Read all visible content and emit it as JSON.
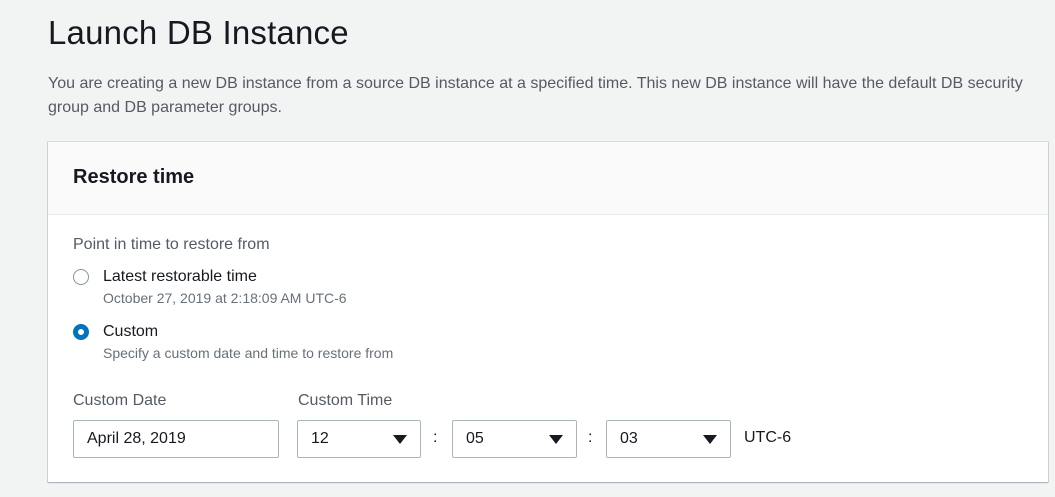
{
  "page": {
    "title": "Launch DB Instance",
    "description": "You are creating a new DB instance from a source DB instance at a specified time. This new DB instance will have the default DB security group and DB parameter groups."
  },
  "restore_panel": {
    "title": "Restore time",
    "point_in_time_label": "Point in time to restore from",
    "options": [
      {
        "label": "Latest restorable time",
        "description": "October 27, 2019 at 2:18:09 AM UTC-6",
        "selected": false
      },
      {
        "label": "Custom",
        "description": "Specify a custom date and time to restore from",
        "selected": true
      }
    ],
    "custom_date": {
      "label": "Custom Date",
      "value": "April 28, 2019"
    },
    "custom_time": {
      "label": "Custom Time",
      "hour": "12",
      "minute": "05",
      "second": "03",
      "separator": ":",
      "timezone": "UTC-6"
    }
  },
  "colors": {
    "accent": "#0073bb",
    "background": "#f2f3f3",
    "panel_header": "#fafafa"
  }
}
